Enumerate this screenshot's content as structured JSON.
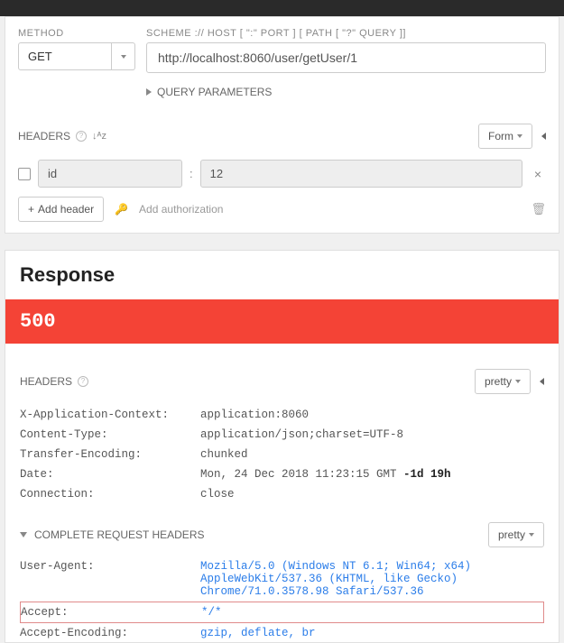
{
  "request": {
    "method_label": "METHOD",
    "method_value": "GET",
    "url_label": "SCHEME :// HOST [ \":\" PORT ] [ PATH [ \"?\" QUERY ]]",
    "url_value": "http://localhost:8060/user/getUser/1",
    "query_params_label": "QUERY PARAMETERS",
    "headers_label": "HEADERS",
    "format_button": "Form",
    "header_row": {
      "name": "id",
      "value": "12"
    },
    "add_header_label": "Add header",
    "add_auth_label": "Add authorization"
  },
  "response": {
    "title": "Response",
    "status": "500",
    "headers_label": "HEADERS",
    "format_button": "pretty",
    "headers": [
      {
        "k": "X-Application-Context:",
        "v": "application:8060"
      },
      {
        "k": "Content-Type:",
        "v": "application/json;charset=UTF-8"
      },
      {
        "k": "Transfer-Encoding:",
        "v": "chunked"
      },
      {
        "k": "Date:",
        "v": "Mon, 24 Dec 2018 11:23:15 GMT",
        "suffix": "-1d 19h"
      },
      {
        "k": "Connection:",
        "v": "close"
      }
    ],
    "complete_req_label": "COMPLETE REQUEST HEADERS",
    "req_format_button": "pretty",
    "req_headers": [
      {
        "k": "User-Agent:",
        "v": "Mozilla/5.0 (Windows NT 6.1; Win64; x64) AppleWebKit/537.36 (KHTML, like Gecko) Chrome/71.0.3578.98 Safari/537.36",
        "blue": true
      },
      {
        "k": "Accept:",
        "v": "*/*",
        "blue": true,
        "hl": true
      },
      {
        "k": "Accept-Encoding:",
        "v": "gzip, deflate, br",
        "blue": true
      }
    ]
  }
}
